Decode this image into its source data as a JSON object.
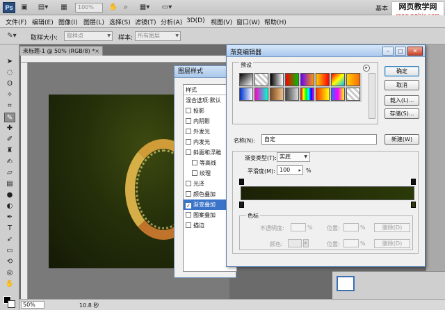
{
  "appbar": {
    "logo": "Ps",
    "zoom": "100%",
    "workspace": "基本",
    "watermark_title": "网页教学网",
    "watermark_url": "www.webjx.com"
  },
  "menu": {
    "items": [
      "文件(F)",
      "编辑(E)",
      "图像(I)",
      "图层(L)",
      "选择(S)",
      "滤镜(T)",
      "分析(A)",
      "3D(D)",
      "视图(V)",
      "窗口(W)",
      "帮助(H)"
    ]
  },
  "options": {
    "sample_size_label": "取样大小:",
    "sample_size_value": "取样点",
    "sample_label": "样本:",
    "sample_value": "所有图层"
  },
  "document": {
    "tab_title": "未标题-1 @ 50% (RGB/8) *",
    "close": "×"
  },
  "status": {
    "zoom": "50%",
    "time": "10.8 秒"
  },
  "layer_style": {
    "title": "图层样式",
    "header": "样式",
    "blend_options": "混合选项:默认",
    "items": [
      {
        "label": "投影",
        "checked": false,
        "sub": false,
        "selected": false
      },
      {
        "label": "内阴影",
        "checked": false,
        "sub": false,
        "selected": false
      },
      {
        "label": "外发光",
        "checked": false,
        "sub": false,
        "selected": false
      },
      {
        "label": "内发光",
        "checked": false,
        "sub": false,
        "selected": false
      },
      {
        "label": "斜面和浮雕",
        "checked": false,
        "sub": false,
        "selected": false
      },
      {
        "label": "等高线",
        "checked": false,
        "sub": true,
        "selected": false
      },
      {
        "label": "纹理",
        "checked": false,
        "sub": true,
        "selected": false
      },
      {
        "label": "光泽",
        "checked": false,
        "sub": false,
        "selected": false
      },
      {
        "label": "颜色叠加",
        "checked": false,
        "sub": false,
        "selected": false
      },
      {
        "label": "渐变叠加",
        "checked": true,
        "sub": false,
        "selected": true
      },
      {
        "label": "图案叠加",
        "checked": false,
        "sub": false,
        "selected": false
      },
      {
        "label": "描边",
        "checked": false,
        "sub": false,
        "selected": false
      }
    ]
  },
  "gradient_editor": {
    "title": "渐变编辑器",
    "presets_label": "预设",
    "buttons": {
      "ok": "确定",
      "cancel": "取消",
      "load": "载入(L)...",
      "save": "存储(S)...",
      "new": "新建(W)"
    },
    "name_label": "名称(N):",
    "name_value": "自定",
    "gradient_type_label": "渐变类型(T):",
    "gradient_type_value": "实底",
    "smoothness_label": "平滑度(M):",
    "smoothness_value": "100",
    "smoothness_unit": "%",
    "stops_label": "色标",
    "opacity_label": "不透明度:",
    "opacity_unit": "%",
    "position_label": "位置:",
    "position_unit": "%",
    "delete_label": "删除(D)",
    "color_label": "颜色:",
    "gradient_colors": {
      "start": "#1c2106",
      "end": "#2b3a08"
    }
  }
}
